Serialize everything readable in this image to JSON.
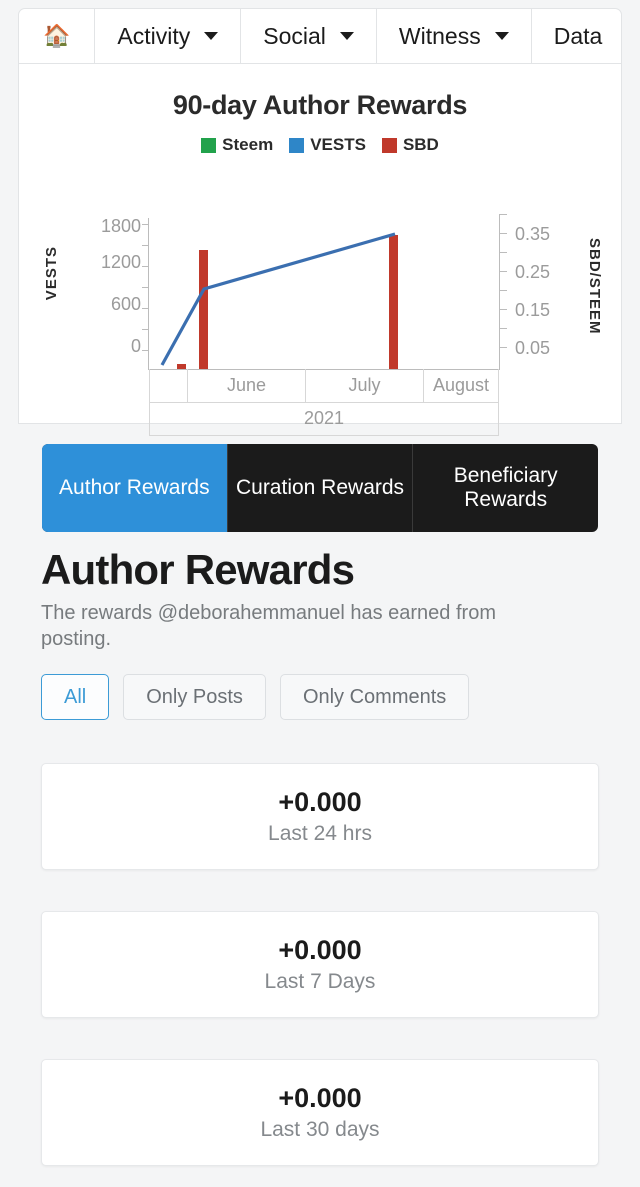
{
  "nav": {
    "items": [
      {
        "label": "",
        "icon": "home-icon",
        "has_caret": false
      },
      {
        "label": "Activity",
        "icon": "",
        "has_caret": true
      },
      {
        "label": "Social",
        "icon": "",
        "has_caret": true
      },
      {
        "label": "Witness",
        "icon": "",
        "has_caret": true
      },
      {
        "label": "Data",
        "icon": "",
        "has_caret": false
      }
    ]
  },
  "chart_data": {
    "type": "line",
    "title": "90-day Author Rewards",
    "xlabel": "2021",
    "ylabel": "VESTS",
    "y2label": "SBD/STEEM",
    "grid": false,
    "legend_position": "top-center",
    "legend": [
      "Steem",
      "VESTS",
      "SBD"
    ],
    "colors": {
      "Steem": "#22a24c",
      "VESTS": "#2e86c8",
      "SBD": "#c0392b"
    },
    "ylim": [
      0,
      2000
    ],
    "yticks": [
      "0",
      "600",
      "1200",
      "1800"
    ],
    "y2lim": [
      0,
      0.4
    ],
    "y2ticks": [
      "0.05",
      "0.15",
      "0.25",
      "0.35"
    ],
    "x_months": [
      "",
      "June",
      "July",
      "August"
    ],
    "x_year": "2021",
    "series": [
      {
        "name": "Steem",
        "axis": "left",
        "type": "line",
        "values": [
          0,
          0,
          0,
          0
        ]
      },
      {
        "name": "VESTS",
        "axis": "left",
        "type": "line",
        "x": [
          0.04,
          0.16,
          0.7
        ],
        "values": [
          60,
          1100,
          1850
        ]
      },
      {
        "name": "SBD",
        "axis": "right",
        "type": "bar",
        "x": [
          0.09,
          0.155,
          0.695
        ],
        "values": [
          0.012,
          0.305,
          0.345
        ]
      }
    ]
  },
  "tabs": [
    {
      "label": "Author Rewards",
      "active": true
    },
    {
      "label": "Curation Rewards",
      "active": false
    },
    {
      "label": "Beneficiary Rewards",
      "active": false
    }
  ],
  "page": {
    "title": "Author Rewards",
    "subtitle": "The rewards @deborahemmanuel has earned from posting."
  },
  "filters": [
    {
      "label": "All",
      "active": true
    },
    {
      "label": "Only Posts",
      "active": false
    },
    {
      "label": "Only Comments",
      "active": false
    }
  ],
  "stats": [
    {
      "value": "+0.000",
      "label": "Last 24 hrs"
    },
    {
      "value": "+0.000",
      "label": "Last 7 Days"
    },
    {
      "value": "+0.000",
      "label": "Last 30 days"
    }
  ]
}
